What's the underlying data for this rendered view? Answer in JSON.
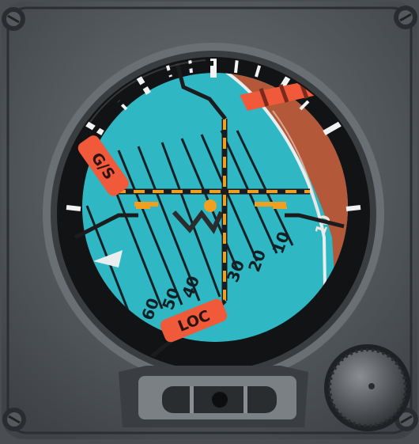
{
  "instrument": {
    "type": "attitude-director-indicator",
    "flags": {
      "glideslope": "G/S",
      "localizer": "LOC"
    },
    "pitch_marks": {
      "lower": [
        "60",
        "50",
        "40",
        "30",
        "20",
        "10"
      ],
      "upper": [
        "10"
      ]
    },
    "colors": {
      "sky": "#2fb8c4",
      "ground": "#b4583a",
      "flag": "#f05a3a",
      "command_bars": "#f0a020",
      "bezel": "#5f6469"
    },
    "icons": [
      "screw-icon",
      "dimming-knob-icon",
      "slip-ball-icon"
    ]
  }
}
